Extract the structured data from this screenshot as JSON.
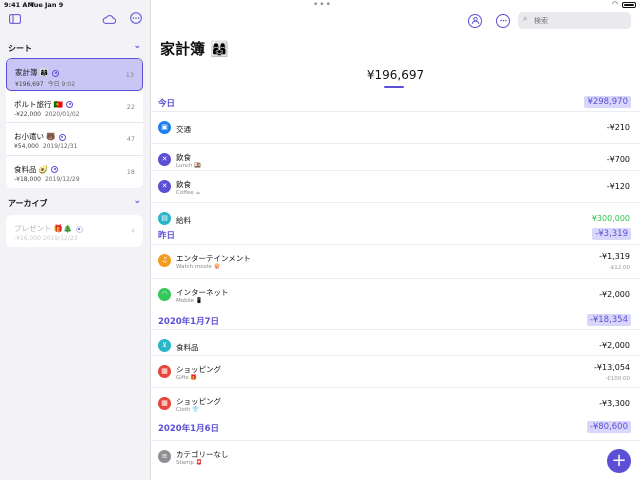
{
  "status": {
    "time": "9:41 AM",
    "date": "Tue Jan 9"
  },
  "sidebar": {
    "sheets_header": "シート",
    "archive_header": "アーカイブ",
    "sheets": [
      {
        "name": "家計簿 👩‍👩‍👧",
        "amount": "¥196,697",
        "date": "今日 9:02",
        "count": "13"
      },
      {
        "name": "ポルト旅行 🇵🇹",
        "amount": "-¥22,000",
        "date": "2020/01/02",
        "count": "22"
      },
      {
        "name": "お小遣い 🐻",
        "amount": "¥54,000",
        "date": "2019/12/31",
        "count": "47"
      },
      {
        "name": "食料品 🥑",
        "amount": "-¥18,000",
        "date": "2019/12/29",
        "count": "18"
      }
    ],
    "archive": [
      {
        "name": "プレゼント 🎁🎄",
        "amount": "-¥16,000",
        "date": "2019/12/23",
        "count": "4"
      }
    ]
  },
  "main": {
    "title": "家計簿 👩‍👩‍👧",
    "total": "¥196,697",
    "search_placeholder": "検索",
    "days": [
      {
        "label": "今日",
        "amount": "¥298,970",
        "rows": [
          {
            "category": "交通",
            "memo": "",
            "amount": "-¥210",
            "sub": "",
            "color": "#1f7ff0",
            "icon": "train-icon"
          },
          {
            "category": "飲食",
            "memo": "Lunch 🍱",
            "amount": "-¥700",
            "sub": "",
            "color": "#5b4fd6",
            "icon": "utensils-icon"
          },
          {
            "category": "飲食",
            "memo": "Coffee ☕",
            "amount": "-¥120",
            "sub": "",
            "color": "#5b4fd6",
            "icon": "utensils-icon"
          },
          {
            "category": "給料",
            "memo": "",
            "amount": "¥300,000",
            "sub": "",
            "color": "#2bb5c8",
            "icon": "salary-icon"
          }
        ]
      },
      {
        "label": "昨日",
        "amount": "-¥3,319",
        "rows": [
          {
            "category": "エンターテインメント",
            "memo": "Watch movie 🍿",
            "amount": "-¥1,319",
            "sub": "-$12.00",
            "color": "#f39c1f",
            "icon": "entertainment-icon"
          },
          {
            "category": "インターネット",
            "memo": "Mobile 📱",
            "amount": "-¥2,000",
            "sub": "",
            "color": "#34c759",
            "icon": "wifi-icon"
          }
        ]
      },
      {
        "label": "2020年1月7日",
        "amount": "-¥18,354",
        "rows": [
          {
            "category": "食料品",
            "memo": "",
            "amount": "-¥2,000",
            "sub": "",
            "color": "#2bb5c8",
            "icon": "cart-icon"
          },
          {
            "category": "ショッピング",
            "memo": "Gifts 🎁",
            "amount": "-¥13,054",
            "sub": "-€100.00",
            "color": "#e8453c",
            "icon": "gift-icon"
          },
          {
            "category": "ショッピング",
            "memo": "Cloth 👕",
            "amount": "-¥3,300",
            "sub": "",
            "color": "#e8453c",
            "icon": "gift-icon"
          }
        ]
      },
      {
        "label": "2020年1月6日",
        "amount": "-¥80,600",
        "rows": [
          {
            "category": "カテゴリーなし",
            "memo": "Stamp 📮",
            "amount": "",
            "sub": "",
            "color": "#8e8e93",
            "icon": "list-icon"
          }
        ]
      }
    ]
  },
  "colors": {
    "accent": "#5b4fd6",
    "income": "#2fbf4a"
  }
}
